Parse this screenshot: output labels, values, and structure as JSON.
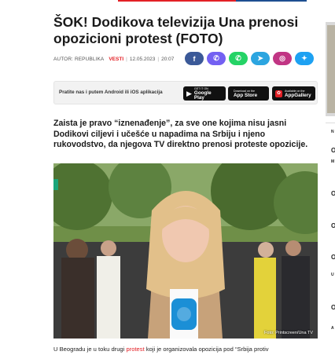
{
  "article": {
    "title": "ŠOK! Dodikova televizija Una prenosi opozicioni protest (FOTO)",
    "author": "AUTOR: REPUBLIKA",
    "category": "VESTI",
    "date": "12.05.2023",
    "time": "20:07",
    "lead": "Zaista je pravo “iznenađenje”, za sve one kojima nisu jasni Dodikovi ciljevi i učešće u napadima na Srbiju i njeno rukovodstvo, da njegova TV direktno prenosi proteste opozicije.",
    "photo_credit": "Foto: Printscreen/Una TV",
    "body_start": "U Beogradu je u toku drugi",
    "body_link": "protest",
    "body_rest": "koji je organizovala opozicija pod “Srbija protiv"
  },
  "share": [
    {
      "name": "facebook",
      "glyph": "f",
      "color": "#3b5998"
    },
    {
      "name": "viber",
      "glyph": "✆",
      "color": "#7360f2"
    },
    {
      "name": "whatsapp",
      "glyph": "✆",
      "color": "#25d366"
    },
    {
      "name": "telegram",
      "glyph": "➤",
      "color": "#2ca5e0"
    },
    {
      "name": "instagram",
      "glyph": "◎",
      "color": "#c13584"
    },
    {
      "name": "twitter",
      "glyph": "✦",
      "color": "#1da1f2"
    }
  ],
  "apps": {
    "prompt": "Pratite nas i putem Android ili iOS aplikacija",
    "google_small": "GET IT ON",
    "google_big": "Google Play",
    "apple_small": "Download on the",
    "apple_big": "App Store",
    "gallery_small": "Available on the",
    "gallery_big": "AppGallery"
  },
  "sidebar": {
    "heading": "N",
    "letters": [
      "O",
      "M",
      "O",
      "O",
      "O",
      "U",
      "O",
      "A"
    ]
  }
}
